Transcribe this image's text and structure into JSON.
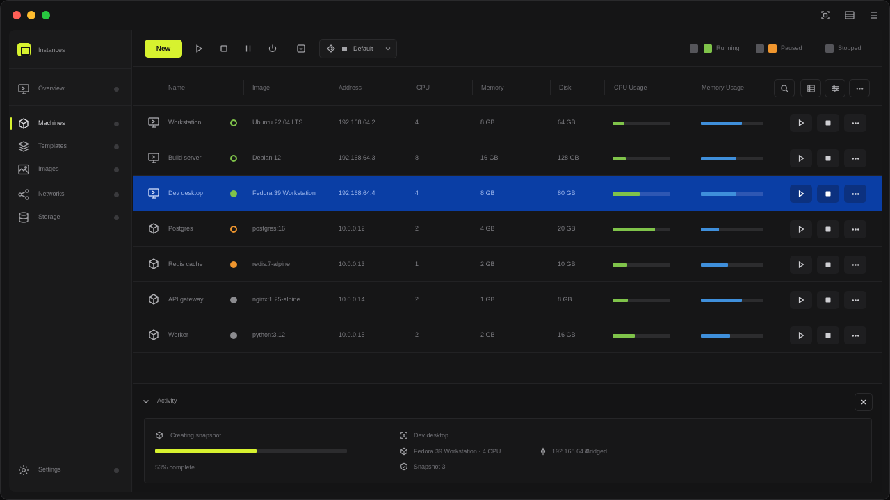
{
  "app": {
    "brand_name": "Instances",
    "colors": {
      "accent": "#d7f22f",
      "selected": "#0a3ea5",
      "running": "#7fc34a",
      "warning": "#f0962e",
      "usage_blue": "#3f8fdb"
    }
  },
  "titlebar": {
    "icons": [
      "sidebar-icon",
      "layout-icon",
      "menu-icon"
    ]
  },
  "sidebar": {
    "top_item": {
      "label": "Overview",
      "icon": "monitor-icon"
    },
    "items": [
      {
        "label": "Machines",
        "icon": "cube-icon",
        "active": true
      },
      {
        "label": "Templates",
        "icon": "layers-icon"
      },
      {
        "label": "Images",
        "icon": "image-icon"
      },
      {
        "label": "Networks",
        "icon": "share-icon"
      },
      {
        "label": "Storage",
        "icon": "database-icon"
      }
    ],
    "bottom_item": {
      "label": "Settings",
      "icon": "gear-icon"
    }
  },
  "toolbar": {
    "primary_label": "New",
    "tools": [
      "play-icon",
      "stop-icon",
      "pause-icon",
      "power-icon",
      "snapshot-icon"
    ],
    "profile": {
      "label": "Default",
      "icon": "diamond-icon"
    },
    "legend": [
      {
        "color": "#7fc34a",
        "label": "Running"
      },
      {
        "color": "#f0962e",
        "label": "Paused"
      },
      {
        "color": "#55555a",
        "label": "Stopped"
      }
    ]
  },
  "table": {
    "columns": [
      "Name",
      "Image",
      "Address",
      "CPU",
      "Memory",
      "Disk",
      "CPU Usage",
      "Memory Usage"
    ],
    "rows": [
      {
        "type": "vm",
        "name": "Workstation",
        "status": "running-outline",
        "image": "Ubuntu 22.04 LTS",
        "address": "192.168.64.2",
        "cpu": "4",
        "memory": "8 GB",
        "disk": "64 GB",
        "cpu_usage": 0.2,
        "mem_usage": 0.65
      },
      {
        "type": "vm",
        "name": "Build server",
        "status": "running-outline",
        "image": "Debian 12",
        "address": "192.168.64.3",
        "cpu": "8",
        "memory": "16 GB",
        "disk": "128 GB",
        "cpu_usage": 0.23,
        "mem_usage": 0.57
      },
      {
        "type": "vm",
        "name": "Dev desktop",
        "status": "running",
        "image": "Fedora 39 Workstation",
        "address": "192.168.64.4",
        "cpu": "4",
        "memory": "8 GB",
        "disk": "80 GB",
        "cpu_usage": 0.47,
        "mem_usage": 0.57,
        "selected": true
      },
      {
        "type": "container",
        "name": "Postgres",
        "status": "paused-outline",
        "image": "postgres:16",
        "address": "10.0.0.12",
        "cpu": "2",
        "memory": "4 GB",
        "disk": "20 GB",
        "cpu_usage": 0.73,
        "mem_usage": 0.29
      },
      {
        "type": "container",
        "name": "Redis cache",
        "status": "paused",
        "image": "redis:7-alpine",
        "address": "10.0.0.13",
        "cpu": "1",
        "memory": "2 GB",
        "disk": "10 GB",
        "cpu_usage": 0.25,
        "mem_usage": 0.43
      },
      {
        "type": "container",
        "name": "API gateway",
        "status": "stopped",
        "image": "nginx:1.25-alpine",
        "address": "10.0.0.14",
        "cpu": "2",
        "memory": "1 GB",
        "disk": "8 GB",
        "cpu_usage": 0.27,
        "mem_usage": 0.65
      },
      {
        "type": "container",
        "name": "Worker",
        "status": "stopped",
        "image": "python:3.12",
        "address": "10.0.0.15",
        "cpu": "2",
        "memory": "2 GB",
        "disk": "16 GB",
        "cpu_usage": 0.39,
        "mem_usage": 0.47
      }
    ]
  },
  "details": {
    "title": "Activity",
    "task_name": "Creating snapshot",
    "task_progress": 0.53,
    "task_status": "53% complete",
    "info": [
      {
        "icon": "image-small-icon",
        "text": "Dev desktop"
      },
      {
        "icon": "cube-small-icon",
        "text": "Fedora 39 Workstation · 4 CPU"
      },
      {
        "icon": "shield-small-icon",
        "text": "Snapshot 3"
      }
    ],
    "extra": {
      "icon": "network-small-icon",
      "label": "192.168.64.4",
      "value": "Bridged"
    }
  }
}
